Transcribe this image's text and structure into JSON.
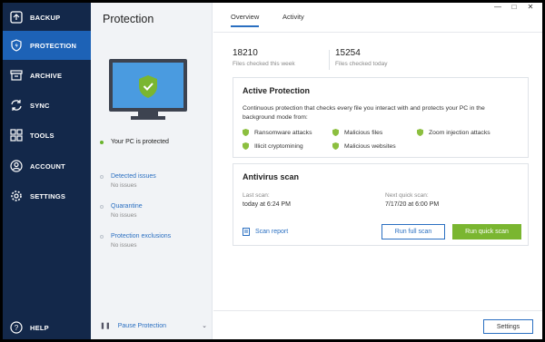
{
  "sidebar": {
    "items": [
      {
        "label": "BACKUP",
        "icon": "backup-icon"
      },
      {
        "label": "PROTECTION",
        "icon": "shield-lightning-icon"
      },
      {
        "label": "ARCHIVE",
        "icon": "archive-icon"
      },
      {
        "label": "SYNC",
        "icon": "sync-icon"
      },
      {
        "label": "TOOLS",
        "icon": "tools-grid-icon"
      },
      {
        "label": "ACCOUNT",
        "icon": "user-icon"
      },
      {
        "label": "SETTINGS",
        "icon": "gear-icon"
      }
    ],
    "help": "HELP"
  },
  "middle": {
    "title": "Protection",
    "status": "Your PC is protected",
    "links": [
      {
        "label": "Detected issues",
        "sub": "No issues"
      },
      {
        "label": "Quarantine",
        "sub": "No issues"
      },
      {
        "label": "Protection exclusions",
        "sub": "No issues"
      }
    ],
    "pause": "Pause Protection"
  },
  "window": {
    "minimize": "—",
    "maximize": "□",
    "close": "✕"
  },
  "tabs": {
    "overview": "Overview",
    "activity": "Activity"
  },
  "stats": {
    "week_num": "18210",
    "week_cap": "Files checked this week",
    "today_num": "15254",
    "today_cap": "Files checked today"
  },
  "active_protection": {
    "title": "Active Protection",
    "description": "Continuous protection that checks every file you interact with and protects your PC in the background mode from:",
    "features": [
      "Ransomware attacks",
      "Malicious files",
      "Zoom injection attacks",
      "Illicit cryptomining",
      "Malicious websites"
    ]
  },
  "antivirus": {
    "title": "Antivirus scan",
    "last_label": "Last scan:",
    "last_value": "today at 6:24 PM",
    "next_label": "Next quick scan:",
    "next_value": "7/17/20 at 6:00 PM",
    "report": "Scan report",
    "full_scan": "Run full scan",
    "quick_scan": "Run quick scan"
  },
  "footer": {
    "settings": "Settings"
  },
  "colors": {
    "sidebar": "#13284a",
    "active": "#1d62b6",
    "accent": "#2a6fc1",
    "green": "#7ab630"
  }
}
